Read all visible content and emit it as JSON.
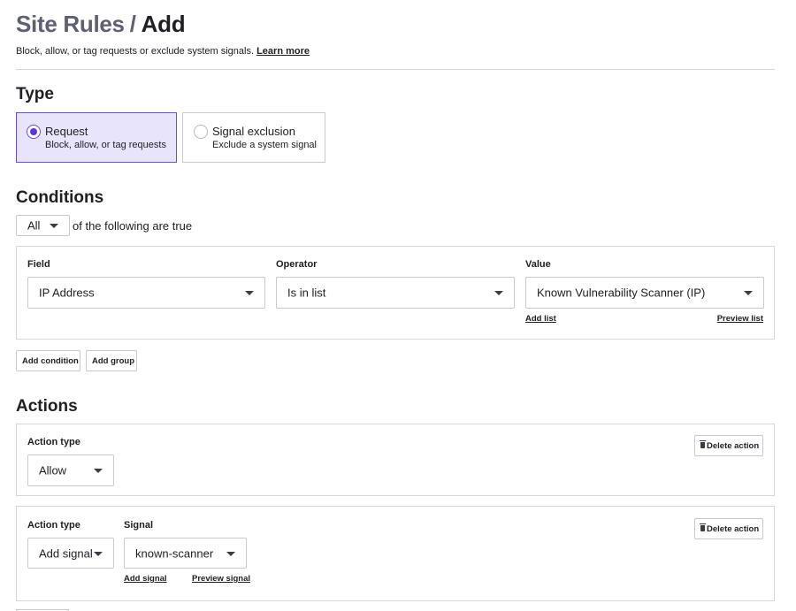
{
  "header": {
    "breadcrumb_parent": "Site Rules",
    "separator": "/",
    "current": "Add",
    "subtitle": "Block, allow, or tag requests or exclude system signals.",
    "learn_more": "Learn more"
  },
  "type_section": {
    "heading": "Type",
    "options": [
      {
        "title": "Request",
        "description": "Block, allow, or tag requests",
        "selected": true
      },
      {
        "title": "Signal exclusion",
        "description": "Exclude a system signal",
        "selected": false
      }
    ]
  },
  "conditions": {
    "heading": "Conditions",
    "match_select": "All",
    "match_suffix": "of the following are true",
    "field_label": "Field",
    "operator_label": "Operator",
    "value_label": "Value",
    "field_value": "IP Address",
    "operator_value": "Is in list",
    "value_value": "Known Vulnerability Scanner (IP)",
    "add_list": "Add list",
    "preview_list": "Preview list",
    "add_condition": "Add condition",
    "add_group": "Add group"
  },
  "actions": {
    "heading": "Actions",
    "items": [
      {
        "type_label": "Action type",
        "type_value": "Allow",
        "delete_label": "Delete action"
      },
      {
        "type_label": "Action type",
        "type_value": "Add signal",
        "signal_label": "Signal",
        "signal_value": "known-scanner",
        "add_signal": "Add signal",
        "preview_signal": "Preview signal",
        "delete_label": "Delete action"
      }
    ]
  },
  "colors": {
    "accent": "#5b38d6",
    "selected_bg": "#e8e4fb",
    "border": "#c9c9cf",
    "muted_title": "#5f6070"
  },
  "icons": [
    "radio-selected",
    "radio-unselected",
    "chevron-down-icon",
    "trash-icon"
  ]
}
